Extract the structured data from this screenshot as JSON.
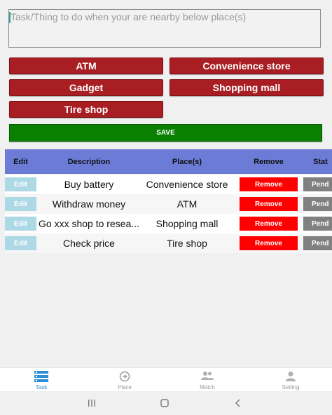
{
  "task_input": {
    "placeholder": "Task/Thing to do when your are nearby below place(s)"
  },
  "places": [
    {
      "label": "ATM"
    },
    {
      "label": "Convenience store"
    },
    {
      "label": "Gadget"
    },
    {
      "label": "Shopping mall"
    },
    {
      "label": "Tire shop"
    }
  ],
  "save_label": "SAVE",
  "table": {
    "headers": {
      "edit": "Edit",
      "description": "Description",
      "places": "Place(s)",
      "remove": "Remove",
      "status": "Stat"
    },
    "rows": [
      {
        "edit": "Edit",
        "description": "Buy battery",
        "place": "Convenience store",
        "remove": "Remove",
        "status": "Pend"
      },
      {
        "edit": "Edit",
        "description": "Withdraw money",
        "place": "ATM",
        "remove": "Remove",
        "status": "Pend"
      },
      {
        "edit": "Edit",
        "description": "Go xxx shop to resea...",
        "place": "Shopping mall",
        "remove": "Remove",
        "status": "Pend"
      },
      {
        "edit": "Edit",
        "description": "Check price",
        "place": "Tire shop",
        "remove": "Remove",
        "status": "Pend"
      }
    ]
  },
  "bottom_nav": [
    {
      "label": "Task",
      "icon": "list-icon",
      "active": true
    },
    {
      "label": "Place",
      "icon": "place-icon",
      "active": false
    },
    {
      "label": "Match",
      "icon": "people-icon",
      "active": false
    },
    {
      "label": "Setting",
      "icon": "user-icon",
      "active": false
    }
  ],
  "colors": {
    "place_button": "#a91e23",
    "save_button": "#0a8000",
    "table_header": "#6b7bd6",
    "edit_button": "#add8e6",
    "remove_button": "#ff0000",
    "status_button": "#808080",
    "nav_active": "#2d8fd5"
  }
}
